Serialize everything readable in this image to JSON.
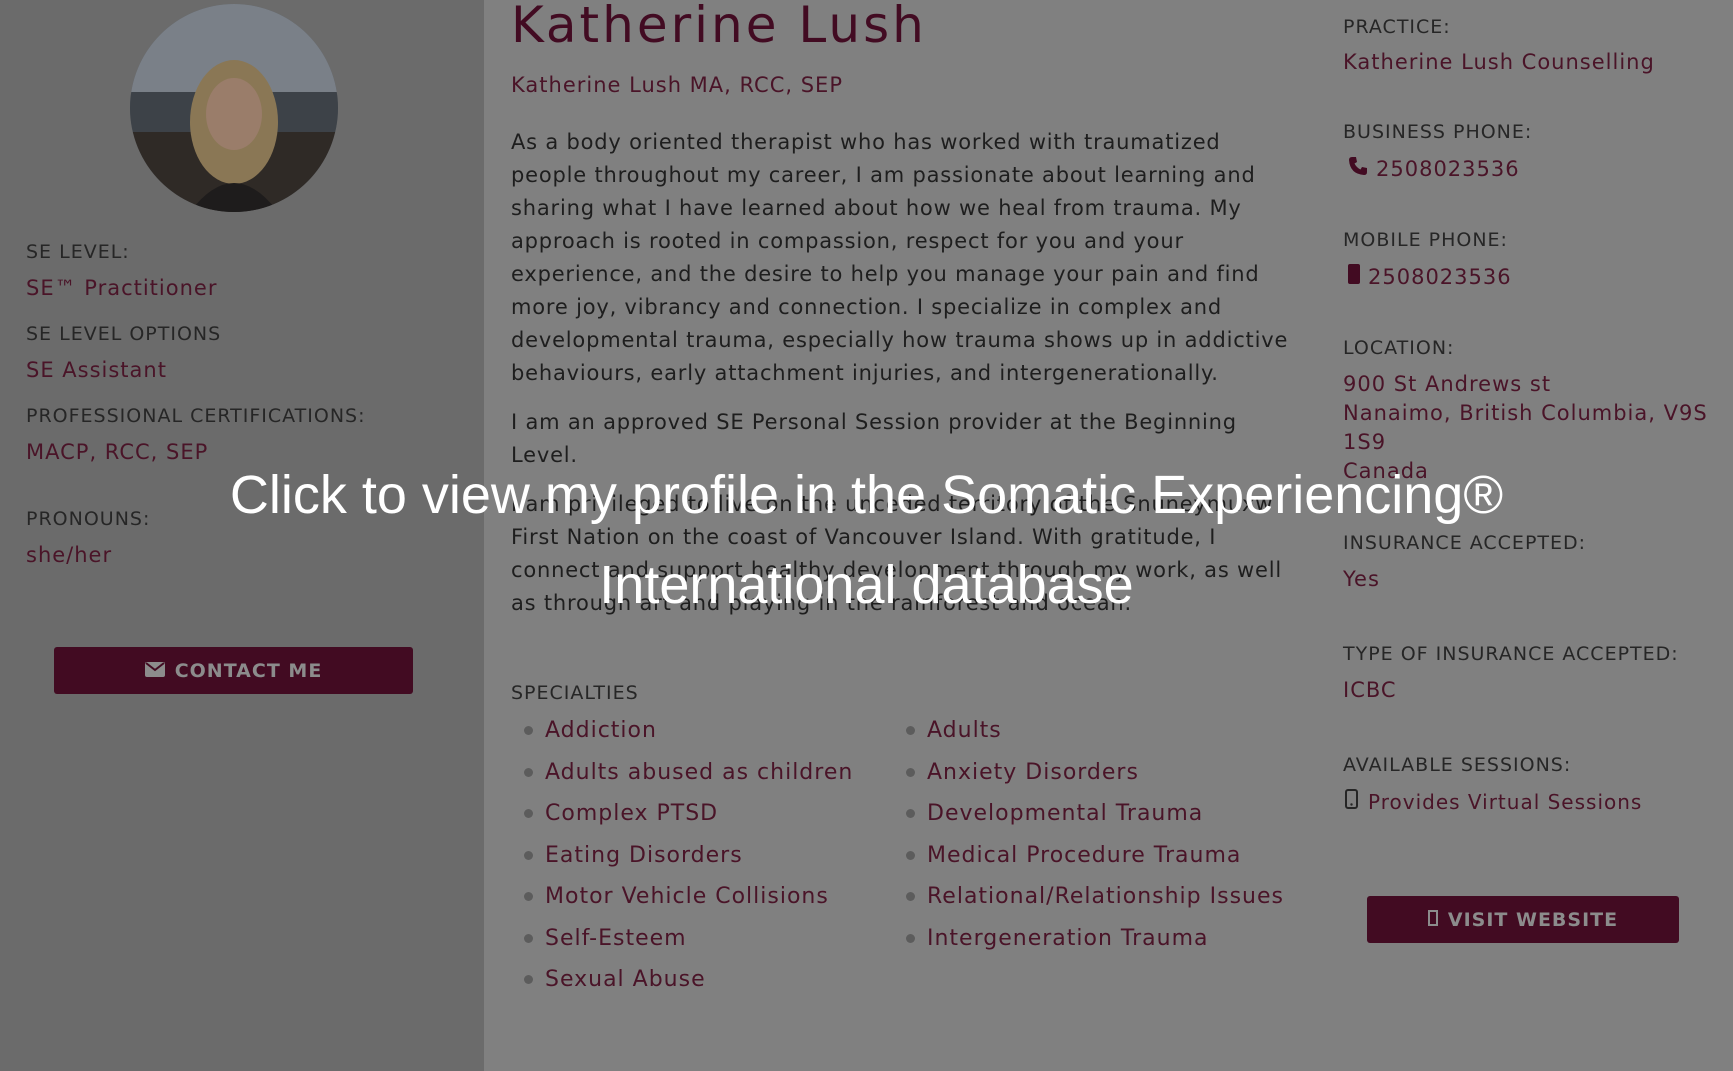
{
  "profile": {
    "name": "Katherine Lush",
    "credentials": "Katherine Lush MA, RCC, SEP",
    "bio": [
      "As a body oriented therapist who has worked with traumatized people throughout my career, I am passionate about learning and sharing what I have learned about how we heal from trauma. My approach is rooted in compassion, respect for you and your experience, and the desire to help you manage your pain and find more joy, vibrancy and connection. I specialize in complex and developmental trauma, especially how trauma shows up in addictive behaviours, early attachment injuries, and intergenerationally.",
      "I am an approved SE Personal Session provider at the Beginning Level.",
      "I am privileged to live on the unceded territory of the Snuneymuxw First Nation on the coast of Vancouver Island. With gratitude, I connect and support healthy development through my work, as well as through art and playing in the rainforest and ocean."
    ]
  },
  "left": {
    "se_level_label": "SE LEVEL:",
    "se_level_value": "SE™ Practitioner",
    "se_options_label": "SE LEVEL OPTIONS",
    "se_options_value": "SE Assistant",
    "certs_label": "PROFESSIONAL CERTIFICATIONS:",
    "certs_value": "MACP, RCC, SEP",
    "pronouns_label": "PRONOUNS:",
    "pronouns_value": "she/her",
    "contact_label": "CONTACT ME"
  },
  "right": {
    "practice_label": "PRACTICE:",
    "practice_value": "Katherine Lush Counselling",
    "business_phone_label": "BUSINESS PHONE:",
    "business_phone_value": "2508023536",
    "mobile_phone_label": "MOBILE PHONE:",
    "mobile_phone_value": "2508023536",
    "location_label": "LOCATION:",
    "location_line1": "900 St Andrews st",
    "location_line2": "Nanaimo, British Columbia, V9S",
    "location_line3": "1S9",
    "location_line4": "Canada",
    "insurance_label": "INSURANCE ACCEPTED:",
    "insurance_value": "Yes",
    "insurance_type_label": "TYPE OF INSURANCE ACCEPTED:",
    "insurance_type_value": "ICBC",
    "sessions_label": "AVAILABLE SESSIONS:",
    "sessions_value": "Provides Virtual Sessions",
    "website_label": "VISIT WEBSITE"
  },
  "specialties": {
    "heading": "SPECIALTIES",
    "col1": [
      "Addiction",
      "Adults abused as children",
      "Complex PTSD",
      "Eating Disorders",
      "Motor Vehicle Collisions",
      "Self-Esteem",
      "Sexual Abuse"
    ],
    "col2": [
      "Adults",
      "Anxiety Disorders",
      "Developmental Trauma",
      "Medical Procedure Trauma",
      "Relational/Relationship Issues",
      "Intergeneration Trauma"
    ]
  },
  "overlay": {
    "line1": "Click to view my profile in the Somatic Experiencing®",
    "line2": "International database"
  },
  "icons": {
    "envelope": "envelope-icon",
    "phone": "phone-icon",
    "mobile": "mobile-icon",
    "external": "external-link-icon"
  }
}
